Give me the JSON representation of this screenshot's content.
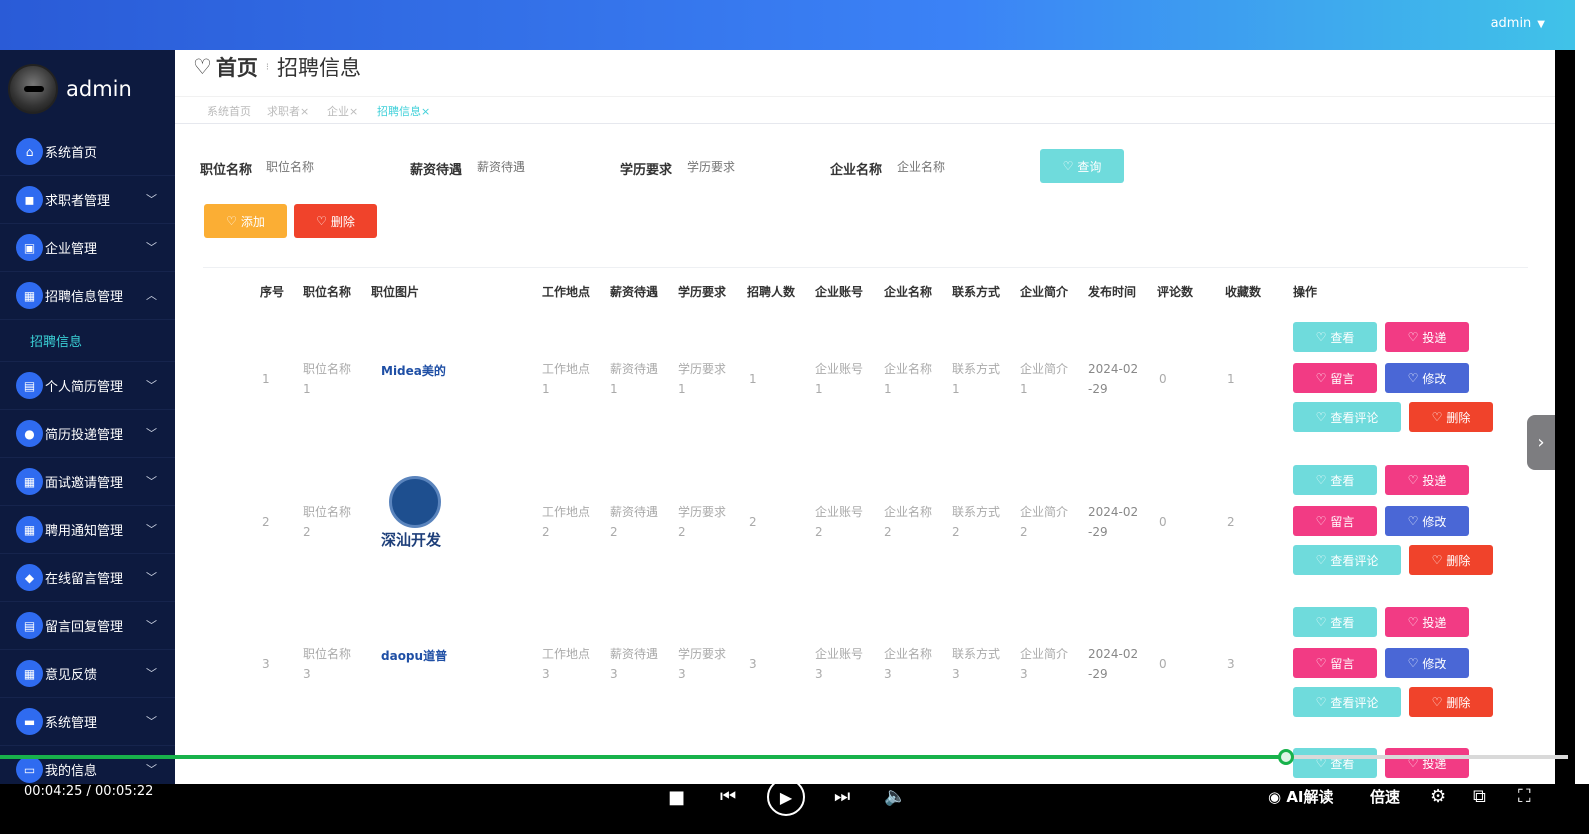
{
  "topbar": {
    "user": "admin"
  },
  "sidebar": {
    "username": "admin",
    "items": [
      {
        "label": "系统首页",
        "icon": "home-icon",
        "glyph": "⌂"
      },
      {
        "label": "求职者管理",
        "icon": "users-icon",
        "glyph": "◼"
      },
      {
        "label": "企业管理",
        "icon": "company-icon",
        "glyph": "▣"
      },
      {
        "label": "招聘信息管理",
        "icon": "grid-icon",
        "glyph": "▦"
      },
      {
        "label": "个人简历管理",
        "icon": "resume-icon",
        "glyph": "▤"
      },
      {
        "label": "简历投递管理",
        "icon": "person-icon",
        "glyph": "●"
      },
      {
        "label": "面试邀请管理",
        "icon": "grid-icon",
        "glyph": "▦"
      },
      {
        "label": "聘用通知管理",
        "icon": "grid-icon",
        "glyph": "▦"
      },
      {
        "label": "在线留言管理",
        "icon": "message-icon",
        "glyph": "◆"
      },
      {
        "label": "留言回复管理",
        "icon": "reply-icon",
        "glyph": "▤"
      },
      {
        "label": "意见反馈",
        "icon": "grid-icon",
        "glyph": "▦"
      },
      {
        "label": "系统管理",
        "icon": "settings-icon",
        "glyph": "▬"
      },
      {
        "label": "我的信息",
        "icon": "profile-icon",
        "glyph": "▭"
      }
    ],
    "sub_item": "招聘信息"
  },
  "breadcrumb": {
    "home": "首页",
    "current": "招聘信息"
  },
  "tabs": [
    "系统首页",
    "求职者×",
    "企业×",
    "招聘信息×"
  ],
  "search": {
    "fields": [
      {
        "label": "职位名称",
        "placeholder": "职位名称"
      },
      {
        "label": "薪资待遇",
        "placeholder": "薪资待遇"
      },
      {
        "label": "学历要求",
        "placeholder": "学历要求"
      },
      {
        "label": "企业名称",
        "placeholder": "企业名称"
      }
    ],
    "query_label": "查询"
  },
  "toolbar": {
    "add_label": "添加",
    "delete_label": "删除"
  },
  "table": {
    "headers": [
      "序号",
      "职位名称",
      "职位图片",
      "工作地点",
      "薪资待遇",
      "学历要求",
      "招聘人数",
      "企业账号",
      "企业名称",
      "联系方式",
      "企业简介",
      "发布时间",
      "评论数",
      "收藏数",
      "操作"
    ],
    "rows": [
      {
        "no": "1",
        "job": "职位名称\n1",
        "logo": "Midea美的",
        "place": "工作地点\n1",
        "salary": "薪资待遇\n1",
        "edu": "学历要求\n1",
        "count": "1",
        "account": "企业账号\n1",
        "company": "企业名称\n1",
        "contact": "联系方式\n1",
        "intro": "企业简介\n1",
        "date": "2024-02\n-29",
        "comments": "0",
        "favs": "1"
      },
      {
        "no": "2",
        "job": "职位名称\n2",
        "logo": "深汕开发",
        "place": "工作地点\n2",
        "salary": "薪资待遇\n2",
        "edu": "学历要求\n2",
        "count": "2",
        "account": "企业账号\n2",
        "company": "企业名称\n2",
        "contact": "联系方式\n2",
        "intro": "企业简介\n2",
        "date": "2024-02\n-29",
        "comments": "0",
        "favs": "2"
      },
      {
        "no": "3",
        "job": "职位名称\n3",
        "logo": "daopu道普",
        "place": "工作地点\n3",
        "salary": "薪资待遇\n3",
        "edu": "学历要求\n3",
        "count": "3",
        "account": "企业账号\n3",
        "company": "企业名称\n3",
        "contact": "联系方式\n3",
        "intro": "企业简介\n3",
        "date": "2024-02\n-29",
        "comments": "0",
        "favs": "3"
      }
    ],
    "actions": {
      "view": "查看",
      "deliver": "投递",
      "message": "留言",
      "edit": "修改",
      "view_comments": "查看评论",
      "delete": "删除"
    }
  },
  "player": {
    "time": "00:04:25 / 00:05:22",
    "progress": 0.82,
    "ai_label": "AI解读",
    "speed_label": "倍速"
  },
  "colors": {
    "teal": "#6fdbdc",
    "pink": "#f23b84",
    "blue": "#4a67d6",
    "red": "#f0432b",
    "orange": "#fbae34",
    "sidebar": "#0d1a3f"
  }
}
